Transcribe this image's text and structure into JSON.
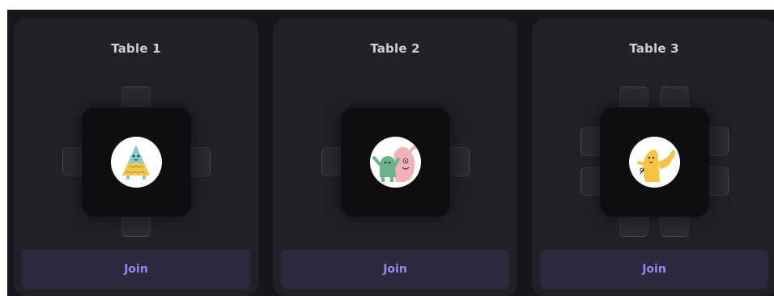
{
  "tables": [
    {
      "title": "Table 1",
      "join_label": "Join",
      "avatar_icon": "blue-cake-character-icon"
    },
    {
      "title": "Table 2",
      "join_label": "Join",
      "avatar_icon": "green-pink-monsters-icon"
    },
    {
      "title": "Table 3",
      "join_label": "Join",
      "avatar_icon": "yellow-waving-character-icon"
    }
  ],
  "colors": {
    "background": "#17161c",
    "card": "#222128",
    "table": "#0e0e11",
    "button": "#2d2a3f",
    "button_text": "#9b86f0",
    "title_text": "#cfced6"
  }
}
